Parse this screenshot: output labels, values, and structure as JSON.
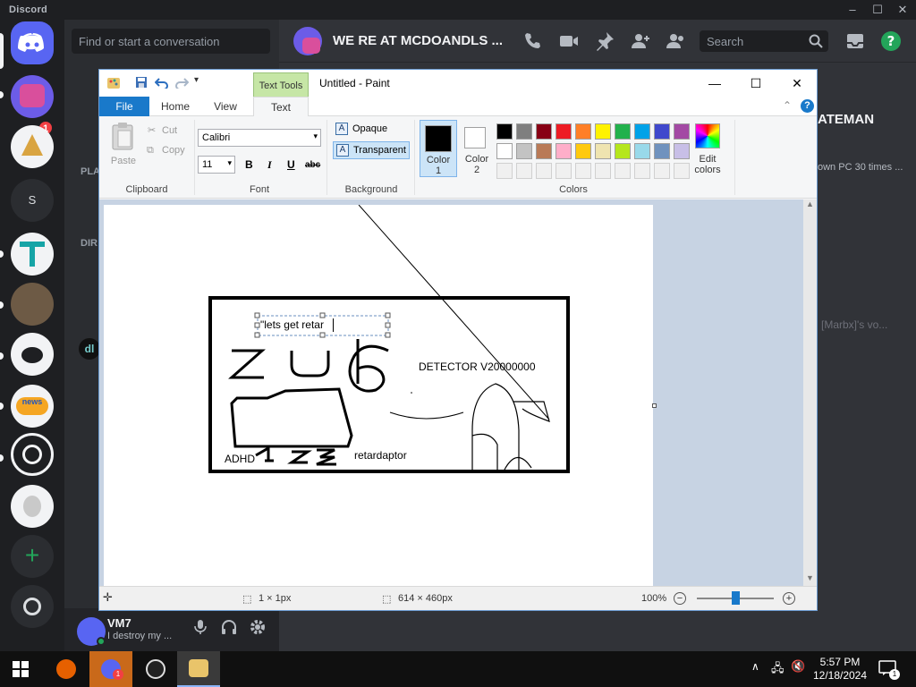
{
  "discord": {
    "brand": "Discord",
    "search_placeholder": "Find or start a conversation",
    "channel_name": "WE RE AT MCDOANDLS ...",
    "header_search_placeholder": "Search",
    "server_badge": "1",
    "server_s_label": "S",
    "user": {
      "name": "VM7",
      "status": "I destroy my ..."
    },
    "bg_snippets": [
      "ATEMAN",
      "own PC 30 times ...",
      "[Marbx]'s vo...",
      "PLA",
      "DIR",
      "dl",
      "news"
    ]
  },
  "paint": {
    "title": "Untitled - Paint",
    "tool_tab": "Text Tools",
    "tabs": [
      "File",
      "Home",
      "View",
      "Text"
    ],
    "clipboard": {
      "paste": "Paste",
      "cut": "Cut",
      "copy": "Copy",
      "label": "Clipboard"
    },
    "font": {
      "family": "Calibri",
      "size": "11",
      "bold": "B",
      "italic": "I",
      "underline": "U",
      "strike": "abc",
      "label": "Font"
    },
    "background": {
      "opaque": "Opaque",
      "transparent": "Transparent",
      "label": "Background"
    },
    "colors": {
      "color1": "Color\n1",
      "color1_a": "Color",
      "color1_b": "1",
      "color2_a": "Color",
      "color2_b": "2",
      "edit_a": "Edit",
      "edit_b": "colors",
      "label": "Colors",
      "color1_value": "#000000",
      "color2_value": "#ffffff",
      "row1": [
        "#000000",
        "#7f7f7f",
        "#880015",
        "#ed1c24",
        "#ff7f27",
        "#fff200",
        "#22b14c",
        "#00a2e8",
        "#3f48cc",
        "#a349a4"
      ],
      "row2": [
        "#ffffff",
        "#c3c3c3",
        "#b97a57",
        "#ffaec9",
        "#ffc90e",
        "#efe4b0",
        "#b5e61d",
        "#99d9ea",
        "#7092be",
        "#c8bfe7"
      ]
    },
    "canvas_text": {
      "typing": "\"lets get retar",
      "detector": "DETECTOR V20000000",
      "adhd": "ADHD",
      "retardaptor": "retardaptor"
    },
    "status": {
      "selection": "1 × 1px",
      "size": "614 × 460px",
      "zoom": "100%",
      "zoom_fraction": 0.5
    }
  },
  "taskbar": {
    "time": "5:57 PM",
    "date": "12/18/2024",
    "notif_count": "1"
  }
}
